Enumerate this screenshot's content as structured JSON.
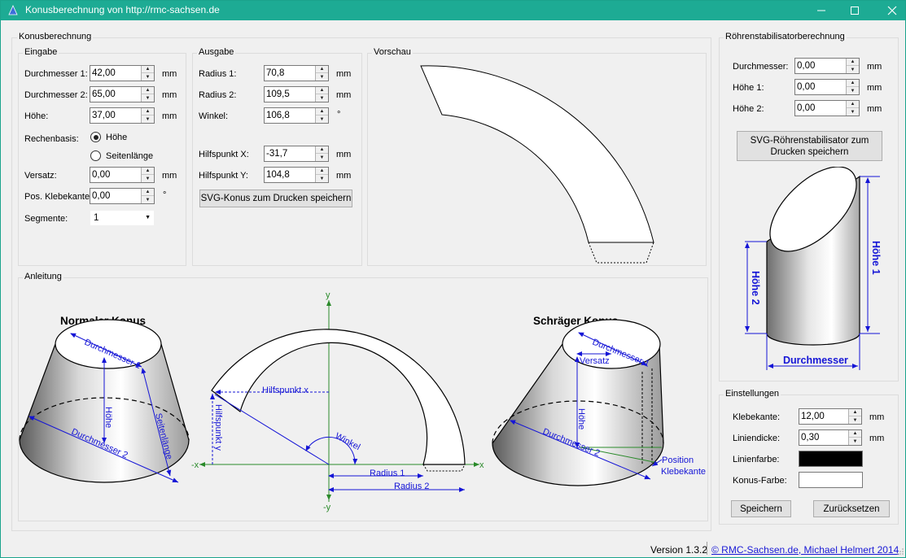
{
  "window": {
    "title": "Konusberechnung von http://rmc-sachsen.de"
  },
  "main_group": {
    "label": "Konusberechnung"
  },
  "eingabe": {
    "label": "Eingabe",
    "durchmesser1": {
      "label": "Durchmesser 1:",
      "value": "42,00",
      "unit": "mm"
    },
    "durchmesser2": {
      "label": "Durchmesser 2:",
      "value": "65,00",
      "unit": "mm"
    },
    "hoehe": {
      "label": "Höhe:",
      "value": "37,00",
      "unit": "mm"
    },
    "rechenbasis": {
      "label": "Rechenbasis:",
      "options": [
        "Höhe",
        "Seitenlänge"
      ],
      "selected": "Höhe"
    },
    "versatz": {
      "label": "Versatz:",
      "value": "0,00",
      "unit": "mm"
    },
    "klebekante": {
      "label": "Pos. Klebekante:",
      "value": "0,00",
      "unit": "°"
    },
    "segmente": {
      "label": "Segmente:",
      "value": "1"
    }
  },
  "ausgabe": {
    "label": "Ausgabe",
    "radius1": {
      "label": "Radius 1:",
      "value": "70,8",
      "unit": "mm"
    },
    "radius2": {
      "label": "Radius 2:",
      "value": "109,5",
      "unit": "mm"
    },
    "winkel": {
      "label": "Winkel:",
      "value": "106,8",
      "unit": "°"
    },
    "hilfx": {
      "label": "Hilfspunkt X:",
      "value": "-31,7",
      "unit": "mm"
    },
    "hilfy": {
      "label": "Hilfspunkt Y:",
      "value": "104,8",
      "unit": "mm"
    },
    "save_button": "SVG-Konus zum Drucken speichern"
  },
  "vorschau": {
    "label": "Vorschau"
  },
  "anleitung": {
    "label": "Anleitung",
    "normal_title": "Normaler Konus",
    "schraeg_title": "Schräger Konus",
    "d1": "Durchmesser 1",
    "d2": "Durchmesser 2",
    "hoehe": "Höhe",
    "seitenlaenge": "Seitenlänge",
    "hilfx": "Hilfspunkt x",
    "hilfy": "Hilfspunkt y",
    "winkel": "Winkel",
    "radius1": "Radius 1",
    "radius2": "Radius 2",
    "versatz": "Versatz",
    "pos1": "Position",
    "pos2": "Klebekante",
    "axis_x": "x",
    "axis_neg_x": "-x",
    "axis_y": "y",
    "axis_neg_y": "-y"
  },
  "roehren": {
    "label": "Röhrenstabilisatorberechnung",
    "durchmesser": {
      "label": "Durchmesser:",
      "value": "0,00",
      "unit": "mm"
    },
    "hoehe1": {
      "label": "Höhe 1:",
      "value": "0,00",
      "unit": "mm"
    },
    "hoehe2": {
      "label": "Höhe 2:",
      "value": "0,00",
      "unit": "mm"
    },
    "save_button": "SVG-Röhrenstabilisator zum Drucken speichern",
    "fig_hoehe1": "Höhe 1",
    "fig_hoehe2": "Höhe 2",
    "fig_durchmesser": "Durchmesser"
  },
  "einstellungen": {
    "label": "Einstellungen",
    "klebekante": {
      "label": "Klebekante:",
      "value": "12,00",
      "unit": "mm"
    },
    "liniendicke": {
      "label": "Liniendicke:",
      "value": "0,30",
      "unit": "mm"
    },
    "linienfarbe": {
      "label": "Linienfarbe:",
      "color": "#000000"
    },
    "konusfarbe": {
      "label": "Konus-Farbe:",
      "color": "#ffffff"
    },
    "save": "Speichern",
    "reset": "Zurücksetzen"
  },
  "status": {
    "version": "Version 1.3.2",
    "link": "© RMC-Sachsen.de, Michael Helmert 2014"
  },
  "colors": {
    "titlebar": "#1dab94",
    "diagram_blue": "#1515d6",
    "axis_green": "#2a8a2a",
    "link": "#1a1ad6"
  }
}
